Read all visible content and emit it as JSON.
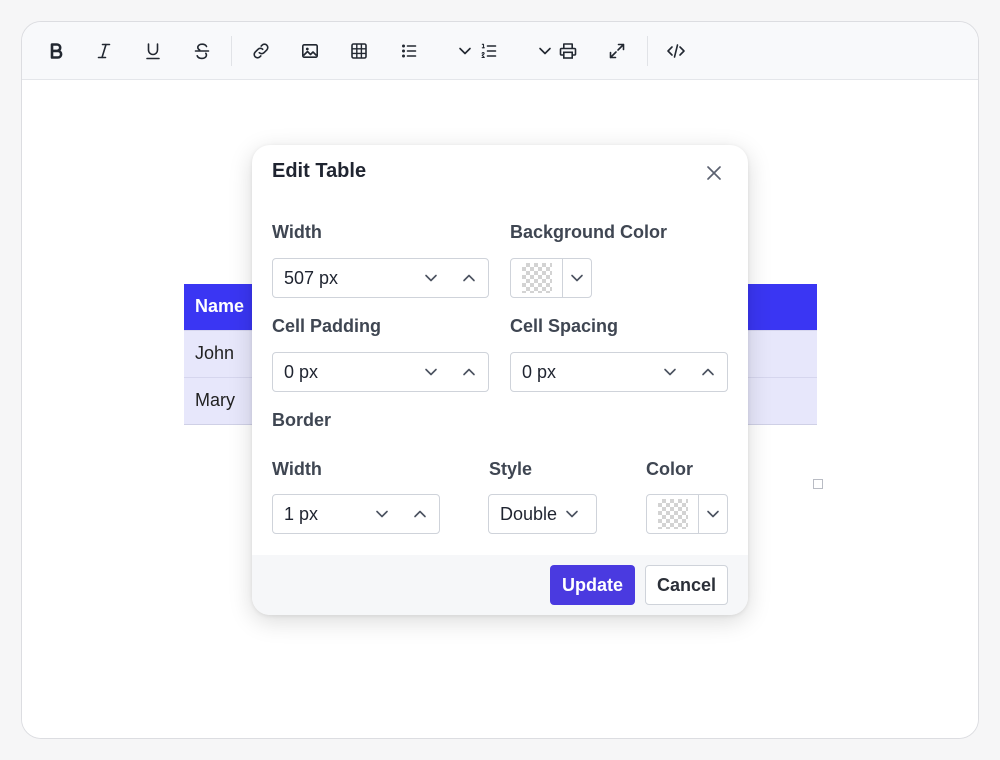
{
  "toolbar": {
    "buttons": [
      "bold-icon",
      "italic-icon",
      "underline-icon",
      "strikethrough-icon",
      "link-icon",
      "image-icon",
      "table-icon",
      "bulleted-list-icon",
      "bulleted-list-options",
      "numbered-list-icon",
      "numbered-list-options",
      "print-icon",
      "fullscreen-icon",
      "source-code-icon"
    ]
  },
  "table": {
    "header": "Name",
    "rows": [
      "John",
      "Mary"
    ]
  },
  "dialog": {
    "title": "Edit Table",
    "width_label": "Width",
    "width_value": "507 px",
    "bg_color_label": "Background Color",
    "cell_padding_label": "Cell Padding",
    "cell_padding_value": "0 px",
    "cell_spacing_label": "Cell Spacing",
    "cell_spacing_value": "0 px",
    "border_label": "Border",
    "border_width_label": "Width",
    "border_width_value": "1 px",
    "border_style_label": "Style",
    "border_style_value": "Double",
    "border_color_label": "Color",
    "update_label": "Update",
    "cancel_label": "Cancel"
  },
  "colors": {
    "accent": "#4a3ae0",
    "table_header": "#3a36f3",
    "table_row": "#e7e7fb"
  }
}
